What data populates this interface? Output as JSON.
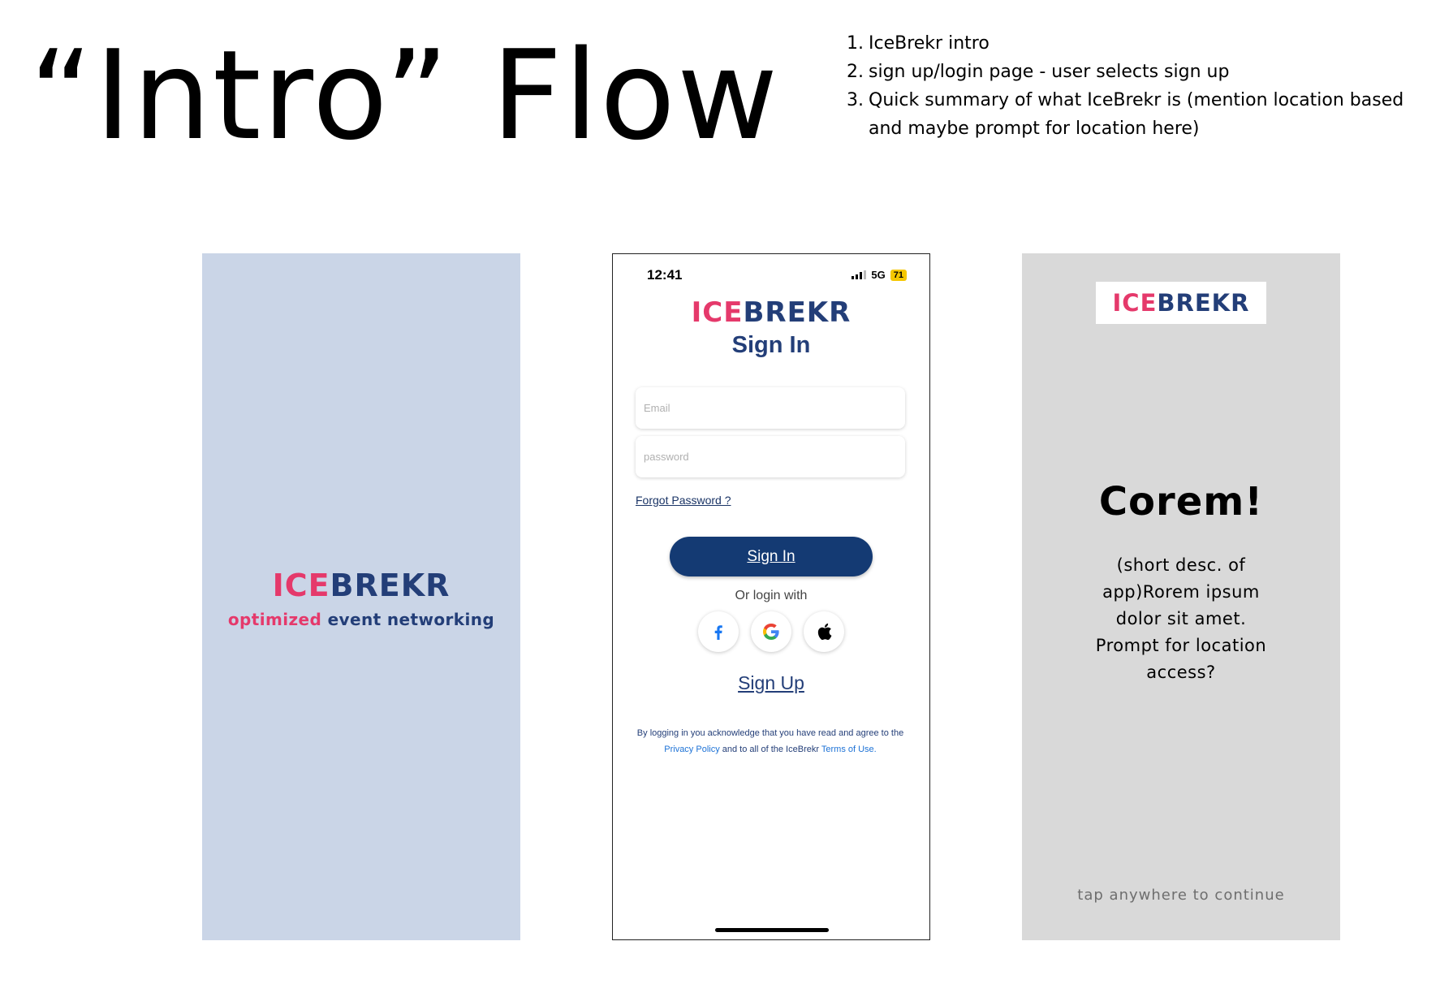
{
  "page": {
    "title": "“Intro” Flow",
    "notes": [
      {
        "num": "1.",
        "text": "IceBrekr intro"
      },
      {
        "num": "2.",
        "text": "sign up/login page - user selects sign up"
      },
      {
        "num": "3.",
        "text": "Quick summary of what IceBrekr is (mention location based and maybe prompt for location here)"
      }
    ]
  },
  "brand": {
    "logo_part1": "ICE",
    "logo_part2": "BREKR",
    "pink": "#e5396b",
    "navy": "#233e78"
  },
  "splash": {
    "tagline_part1": "optimized",
    "tagline_part2": "event networking",
    "background": "#cad5e7"
  },
  "signin": {
    "status_time": "12:41",
    "status_network": "5G",
    "status_battery": "71",
    "heading": "Sign In",
    "email_placeholder": "Email",
    "password_placeholder": "password",
    "forgot_label": "Forgot Password ?",
    "signin_button": "Sign In",
    "or_text": "Or login with",
    "social_icons": [
      "facebook-icon",
      "google-icon",
      "apple-icon"
    ],
    "signup_link": "Sign Up",
    "legal_part1": "By logging in you acknowledge that you have read and agree to the ",
    "legal_link1": "Privacy Policy",
    "legal_part2": " and to all of the IceBrekr ",
    "legal_link2": "Terms of Use.",
    "button_color": "#143a73"
  },
  "summary": {
    "heading": "Corem!",
    "description": "(short desc. of app)Rorem ipsum dolor sit amet.\nPrompt for location access?",
    "tap_hint": "tap anywhere to continue",
    "background": "#d9d9d9"
  }
}
